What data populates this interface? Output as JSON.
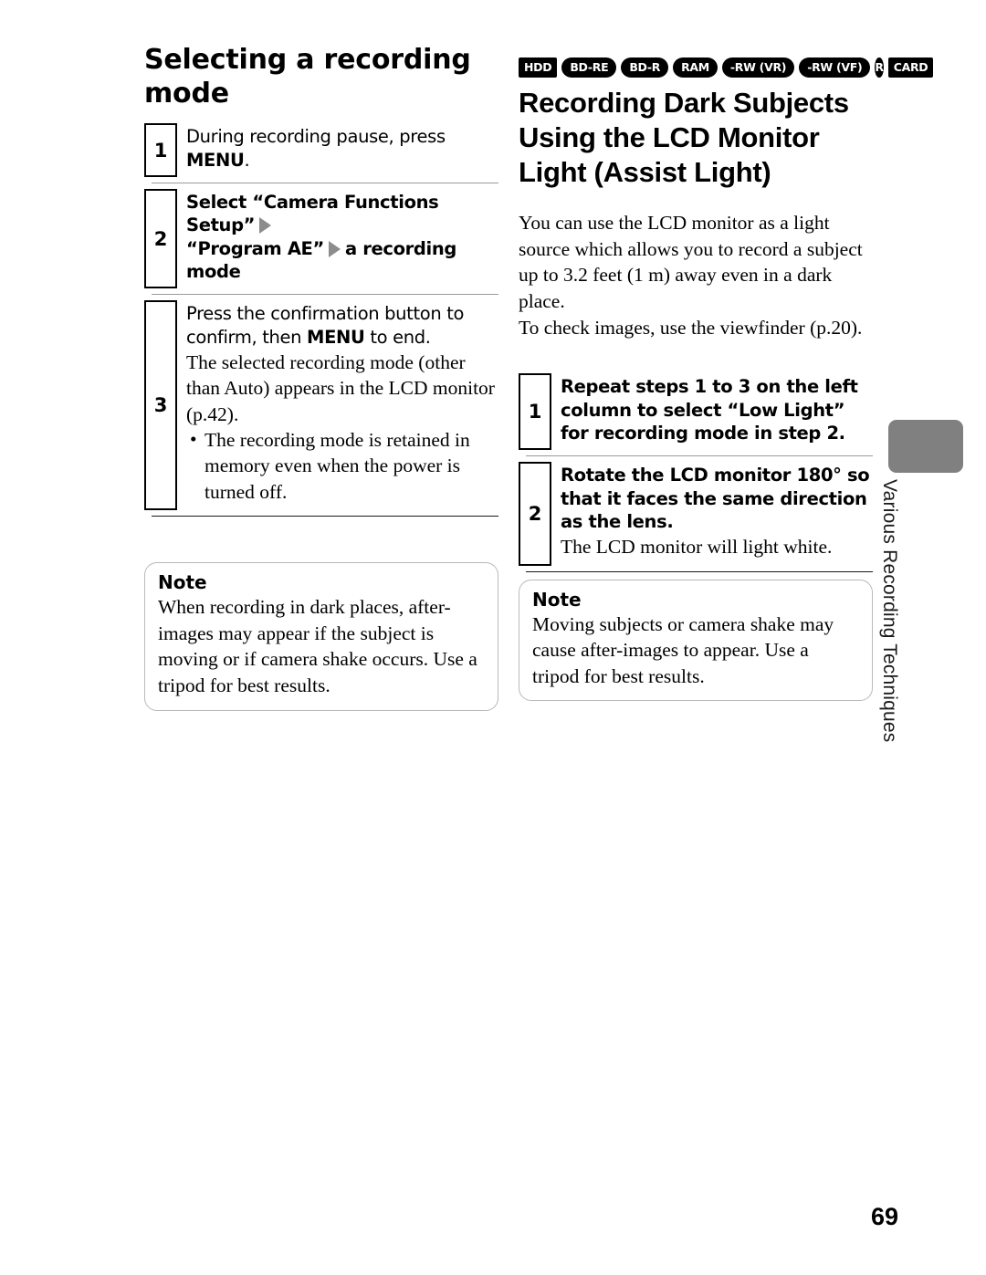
{
  "page": {
    "number": "69",
    "side_tab_label": "Various Recording Techniques"
  },
  "left_column": {
    "heading": "Selecting a recording mode",
    "steps": [
      {
        "number": "1",
        "instruction_pre": "During recording pause, press ",
        "instruction_bold": "MENU",
        "instruction_post": "."
      },
      {
        "number": "2",
        "line1": "Select “Camera Functions Setup”",
        "line2_a": "“Program AE”",
        "line2_b": "a recording mode"
      },
      {
        "number": "3",
        "instruction_pre": "Press the confirmation button to confirm, then ",
        "instruction_bold": "MENU",
        "instruction_post": " to end.",
        "explain": "The selected recording mode (other than Auto) appears in the LCD monitor (p.42).",
        "bullets": [
          "The recording mode is retained in memory even when the power is turned off."
        ]
      }
    ],
    "note": {
      "title": "Note",
      "body": "When recording in dark places, after-images may appear if the subject is moving or if camera shake occurs. Use a tripod for best results."
    }
  },
  "right_column": {
    "badges": [
      {
        "label": "HDD",
        "shape": "rect"
      },
      {
        "label": "BD-RE",
        "shape": "pill"
      },
      {
        "label": "BD-R",
        "shape": "pill"
      },
      {
        "label": "RAM",
        "shape": "pill"
      },
      {
        "label": "-RW (VR)",
        "shape": "pill"
      },
      {
        "label": "-RW (VF)",
        "shape": "pill"
      },
      {
        "label": "R",
        "shape": "circle"
      },
      {
        "label": "CARD",
        "shape": "rect"
      }
    ],
    "heading": "Recording Dark Subjects Using the LCD Monitor Light (Assist Light)",
    "intro_p1": "You can use the LCD monitor as a light source which allows you to record a subject up to 3.2 feet (1 m) away even in a dark place.",
    "intro_p2": "To check images, use the viewfinder (p.20).",
    "steps": [
      {
        "number": "1",
        "instruction": "Repeat steps 1 to 3 on the left column to select “Low Light” for recording mode in step 2."
      },
      {
        "number": "2",
        "instruction": "Rotate the LCD monitor 180° so that it faces the same direction as the lens.",
        "explain": "The LCD monitor will light white."
      }
    ],
    "note": {
      "title": "Note",
      "body": "Moving subjects or camera shake may cause after-images to appear. Use a tripod for best results."
    }
  },
  "colors": {
    "badge_bg": "#000000",
    "badge_fg": "#ffffff",
    "arrow_gray": "#8c8c8c",
    "separator_gray": "#9a9a9a",
    "note_border": "#b9b9b9",
    "side_tab": "#808080"
  }
}
